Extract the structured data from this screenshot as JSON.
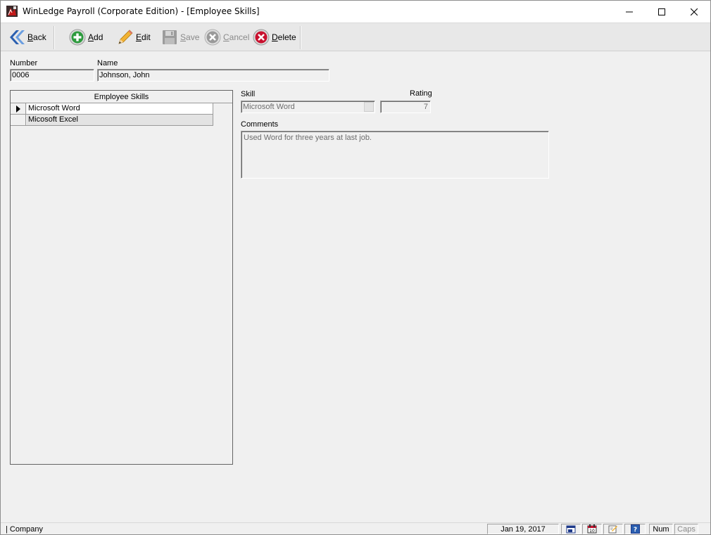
{
  "window": {
    "title": "WinLedge Payroll (Corporate Edition) - [Employee Skills]"
  },
  "toolbar": {
    "back": {
      "label_prefix": "",
      "mnemonic": "B",
      "label_rest": "ack",
      "icon": "double-chevron-left-icon",
      "enabled": true
    },
    "add": {
      "mnemonic": "A",
      "label_rest": "dd",
      "icon": "plus-circle-icon",
      "enabled": true
    },
    "edit": {
      "mnemonic": "E",
      "label_rest": "dit",
      "icon": "pencil-icon",
      "enabled": true
    },
    "save": {
      "mnemonic": "S",
      "label_rest": "ave",
      "icon": "floppy-disk-icon",
      "enabled": false
    },
    "cancel": {
      "mnemonic": "C",
      "label_rest": "ancel",
      "icon": "x-circle-icon",
      "enabled": false
    },
    "delete": {
      "mnemonic": "D",
      "label_rest": "elete",
      "icon": "red-x-circle-icon",
      "enabled": true
    }
  },
  "employee": {
    "number_label": "Number",
    "number_value": "0006",
    "name_label": "Name",
    "name_value": "Johnson, John"
  },
  "skills_grid": {
    "header": "Employee Skills",
    "rows": [
      {
        "skill": "Microsoft Word",
        "selected": true
      },
      {
        "skill": "Micosoft Excel",
        "selected": false
      }
    ]
  },
  "detail": {
    "skill_label": "Skill",
    "skill_value": "Microsoft Word",
    "rating_label": "Rating",
    "rating_value": "7",
    "comments_label": "Comments",
    "comments_value": "Used Word for three years at last job."
  },
  "statusbar": {
    "company": "| Company",
    "date": "Jan 19, 2017",
    "num": "Num",
    "caps": "Caps"
  },
  "colors": {
    "accent_green": "#2e9b3e",
    "accent_red": "#c8102e",
    "back_blue": "#2a5fb0",
    "disabled_text": "#8a8a8a"
  }
}
